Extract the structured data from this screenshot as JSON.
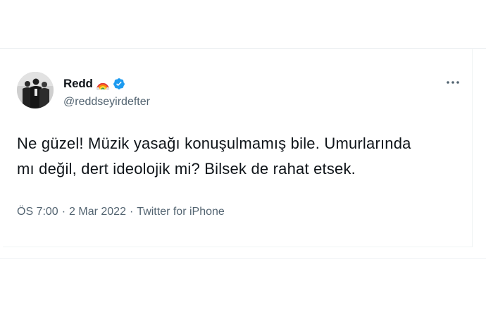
{
  "tweet": {
    "display_name": "Redd",
    "name_emoji_icon": "rainbow-emoji-icon",
    "verified_icon": "verified-badge-icon",
    "handle": "@reddseyirdefter",
    "more_icon": "more-options-icon",
    "text_line1": "Ne güzel! Müzik yasağı konuşulmamış bile. Umurlarında",
    "text_line2": "mı değil, dert ideolojik mi? Bilsek de rahat etsek.",
    "time": "ÖS 7:00",
    "separator": "·",
    "date": "2 Mar 2022",
    "source": "Twitter for iPhone"
  },
  "colors": {
    "text_primary": "#0f1419",
    "text_secondary": "#536471",
    "verified_blue": "#1d9bf0",
    "divider": "#eff3f4"
  }
}
